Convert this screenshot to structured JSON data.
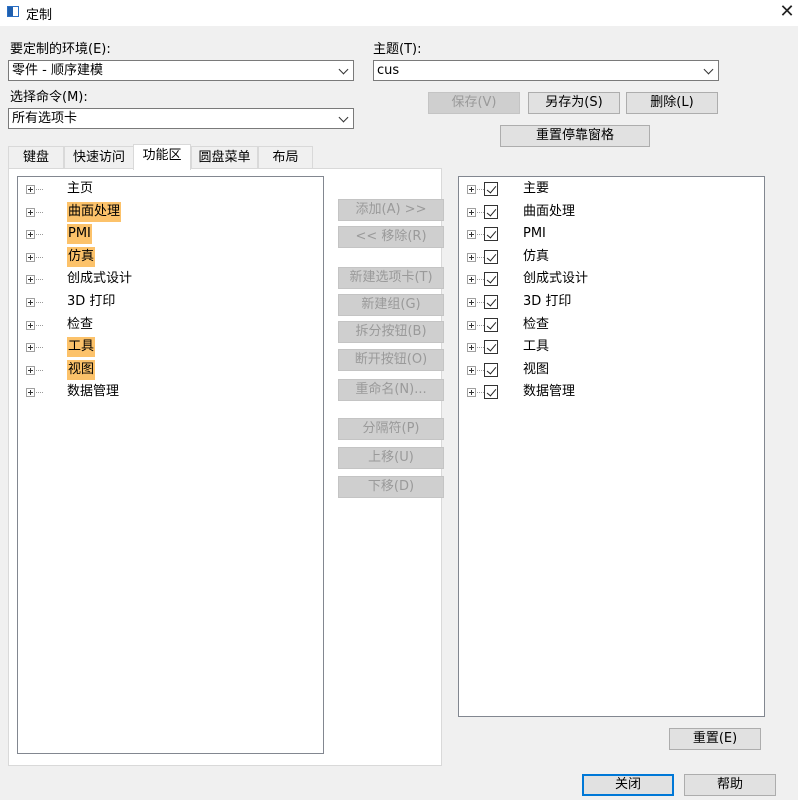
{
  "window": {
    "title": "定制",
    "close_glyph": "✕"
  },
  "env": {
    "label": "要定制的环境(E):",
    "value": "零件 - 顺序建模"
  },
  "command": {
    "label": "选择命令(M):",
    "value": "所有选项卡"
  },
  "theme": {
    "label": "主题(T):",
    "value": "cus"
  },
  "buttons": {
    "save": "保存(V)",
    "save_as": "另存为(S)",
    "delete": "删除(L)",
    "reset_dock": "重置停靠窗格",
    "add": "添加(A) >>",
    "remove": "<< 移除(R)",
    "new_tab": "新建选项卡(T)",
    "new_group": "新建组(G)",
    "split_button": "拆分按钮(B)",
    "break_button": "断开按钮(O)",
    "rename": "重命名(N)...",
    "separator": "分隔符(P)",
    "move_up": "上移(U)",
    "move_down": "下移(D)",
    "reset": "重置(E)",
    "close": "关闭",
    "help": "帮助"
  },
  "tabs": [
    "键盘",
    "快速访问",
    "功能区",
    "圆盘菜单",
    "布局"
  ],
  "active_tab": "功能区",
  "left_tree": [
    {
      "label": "主页",
      "highlighted": false
    },
    {
      "label": "曲面处理",
      "highlighted": true
    },
    {
      "label": "PMI",
      "highlighted": true
    },
    {
      "label": "仿真",
      "highlighted": true
    },
    {
      "label": "创成式设计",
      "highlighted": false
    },
    {
      "label": "3D 打印",
      "highlighted": false
    },
    {
      "label": "检查",
      "highlighted": false
    },
    {
      "label": "工具",
      "highlighted": true
    },
    {
      "label": "视图",
      "highlighted": true
    },
    {
      "label": "数据管理",
      "highlighted": false
    }
  ],
  "right_tree": [
    {
      "label": "主要",
      "checked": true
    },
    {
      "label": "曲面处理",
      "checked": true
    },
    {
      "label": "PMI",
      "checked": true
    },
    {
      "label": "仿真",
      "checked": true
    },
    {
      "label": "创成式设计",
      "checked": true
    },
    {
      "label": "3D 打印",
      "checked": true
    },
    {
      "label": "检查",
      "checked": true
    },
    {
      "label": "工具",
      "checked": true
    },
    {
      "label": "视图",
      "checked": true
    },
    {
      "label": "数据管理",
      "checked": true
    }
  ],
  "colors": {
    "highlight": "#fcc26a",
    "dialog_bg": "#f0f0f0"
  }
}
